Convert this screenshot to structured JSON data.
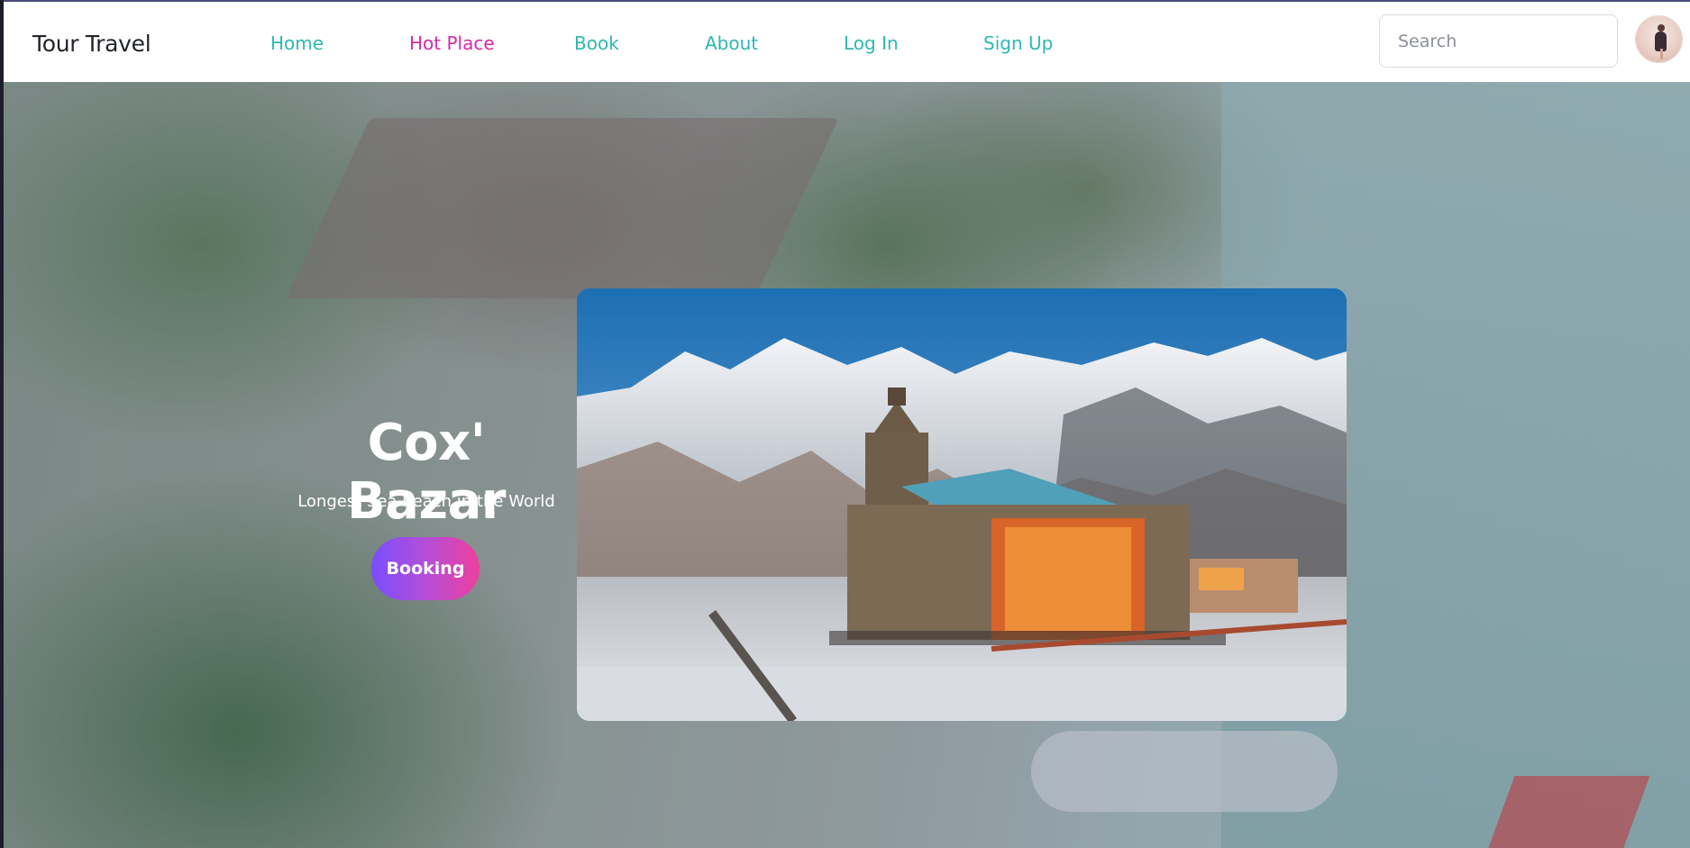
{
  "brand": "Tour Travel",
  "nav": [
    {
      "label": "Home",
      "active": false
    },
    {
      "label": "Hot Place",
      "active": true
    },
    {
      "label": "Book",
      "active": false
    },
    {
      "label": "About",
      "active": false
    },
    {
      "label": "Log In",
      "active": false
    },
    {
      "label": "Sign Up",
      "active": false
    }
  ],
  "search": {
    "placeholder": "Search",
    "value": ""
  },
  "hero": {
    "title": "Cox' Bazar",
    "subtitle": "Longest Sea beach in the World",
    "button_label": "Booking"
  },
  "colors": {
    "nav_link": "#2fb7b3",
    "nav_active": "#d62aa6",
    "button_gradient": [
      "#7a4dff",
      "#ee3f9e"
    ]
  }
}
